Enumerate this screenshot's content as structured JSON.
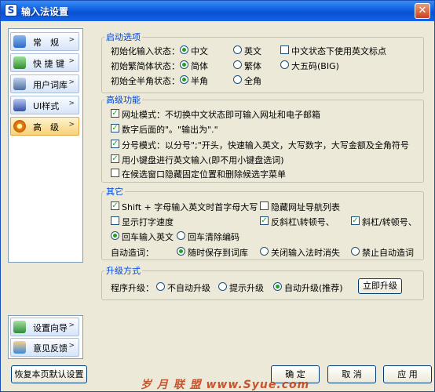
{
  "window": {
    "title": "输入法设置"
  },
  "sidebar": {
    "items": [
      {
        "label": "常　规",
        "icon": "wrench-icon"
      },
      {
        "label": "快 捷 键",
        "icon": "shortcut-icon"
      },
      {
        "label": "用户词库",
        "icon": "dictionary-icon"
      },
      {
        "label": "UI样式",
        "icon": "style-icon"
      },
      {
        "label": "高　级",
        "icon": "gear-icon"
      }
    ],
    "bottom": [
      {
        "label": "设置向导",
        "icon": "wizard-icon"
      },
      {
        "label": "意见反馈",
        "icon": "feedback-icon"
      }
    ]
  },
  "startup": {
    "legend": "启动选项",
    "row1": {
      "label": "初始化输入状态：",
      "opt1": "中文",
      "opt2": "英文",
      "check": "中文状态下使用英文标点"
    },
    "row2": {
      "label": "初始繁简体状态：",
      "opt1": "简体",
      "opt2": "繁体",
      "opt3": "大五码(BIG)"
    },
    "row3": {
      "label": "初始全半角状态：",
      "opt1": "半角",
      "opt2": "全角"
    }
  },
  "advanced": {
    "legend": "高级功能",
    "items": [
      {
        "label": "网址模式：不切换中文状态即可输入网址和电子邮箱",
        "checked": true
      },
      {
        "label": "数字后面的\"。\"输出为\".\"",
        "checked": true
      },
      {
        "label": "分号模式：以分号\";\"开头，快速输入英文，大写数字，大写金额及全角符号",
        "checked": true
      },
      {
        "label": "用小键盘进行英文输入(即不用小键盘选词)",
        "checked": true
      },
      {
        "label": "在候选窗口隐藏固定位置和删除候选字菜单",
        "checked": false
      }
    ]
  },
  "other": {
    "legend": "其它",
    "shift_caps": "Shift + 字母输入英文时首字母大写",
    "hide_url_nav": "隐藏网址导航列表",
    "show_speed": "显示打字速度",
    "backslash": "反斜杠\\转顿号、",
    "slash": "斜杠/转顿号、",
    "enter_opt1": "回车输入英文",
    "enter_opt2": "回车清除编码",
    "auto_word_label": "自动造词：",
    "auto_word_opt1": "随时保存到词库",
    "auto_word_opt2": "关闭输入法时消失",
    "auto_word_opt3": "禁止自动造词"
  },
  "upgrade": {
    "legend": "升级方式",
    "label": "程序升级：",
    "opt1": "不自动升级",
    "opt2": "提示升级",
    "opt3": "自动升级(推荐)",
    "button": "立即升级"
  },
  "footer": {
    "restore": "恢复本页默认设置",
    "ok": "确 定",
    "cancel": "取 消",
    "apply": "应 用"
  },
  "watermark": "岁 月 联 盟  www.Syue.com",
  "colors": {
    "title_bar": "#0d5fe0",
    "legend": "#0046d5",
    "check": "#21a121",
    "dialog_bg": "#ece9d8"
  }
}
